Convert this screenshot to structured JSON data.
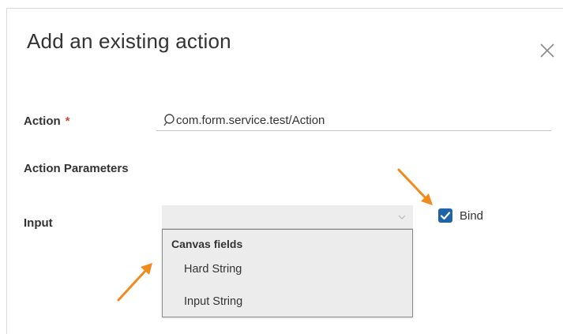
{
  "dialog": {
    "title": "Add an existing action",
    "close_icon": "close-icon"
  },
  "form": {
    "action_label": "Action",
    "required_marker": "*",
    "action_value": "com.form.service.test/Action",
    "parameters_heading": "Action Parameters",
    "input_label": "Input",
    "input_value": "",
    "bind_label": "Bind",
    "bind_checked": true
  },
  "dropdown": {
    "group_label": "Canvas fields",
    "options": [
      {
        "label": "Hard String"
      },
      {
        "label": "Input String"
      }
    ]
  },
  "colors": {
    "accent": "#1e64a6",
    "required": "#d0453e",
    "annotation_arrow": "#f28a1c"
  }
}
